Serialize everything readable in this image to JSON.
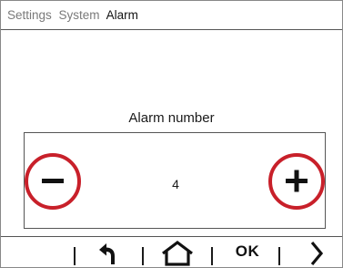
{
  "breadcrumb": {
    "items": [
      {
        "label": "Settings"
      },
      {
        "label": "System"
      },
      {
        "label": "Alarm"
      }
    ]
  },
  "main": {
    "title": "Alarm number",
    "value": "4",
    "decrement_icon": "minus-icon",
    "increment_icon": "plus-icon",
    "highlight_color": "#c8202a"
  },
  "bottom_bar": {
    "back_icon": "back-arrow-icon",
    "home_icon": "home-icon",
    "ok_label": "OK",
    "next_icon": "chevron-right-icon"
  }
}
